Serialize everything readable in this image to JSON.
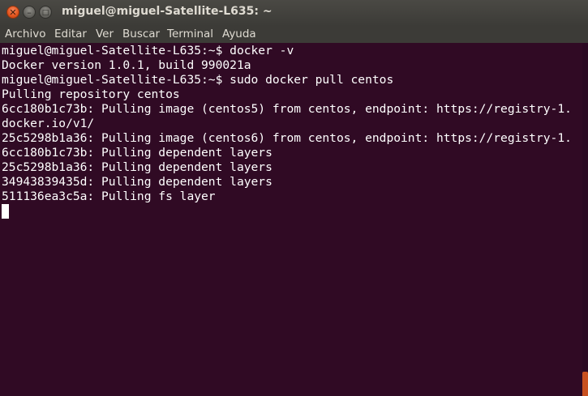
{
  "window": {
    "title": "miguel@miguel-Satellite-L635: ~",
    "buttons": {
      "close": "✕",
      "minimize": "–",
      "maximize": "□"
    }
  },
  "menu": {
    "items": [
      "Archivo",
      "Editar",
      "Ver",
      "Buscar",
      "Terminal",
      "Ayuda"
    ]
  },
  "terminal": {
    "lines": [
      "miguel@miguel-Satellite-L635:~$ docker -v",
      "Docker version 1.0.1, build 990021a",
      "miguel@miguel-Satellite-L635:~$ sudo docker pull centos",
      "Pulling repository centos",
      "6cc180b1c73b: Pulling image (centos5) from centos, endpoint: https://registry-1.",
      "docker.io/v1/",
      "25c5298b1a36: Pulling image (centos6) from centos, endpoint: https://registry-1.",
      "6cc180b1c73b: Pulling dependent layers",
      "25c5298b1a36: Pulling dependent layers",
      "34943839435d: Pulling dependent layers",
      "511136ea3c5a: Pulling fs layer"
    ]
  },
  "colors": {
    "terminal_bg": "#300a24",
    "terminal_fg": "#ffffff",
    "titlebar": "#3c3b37",
    "close_button": "#e1531c"
  }
}
